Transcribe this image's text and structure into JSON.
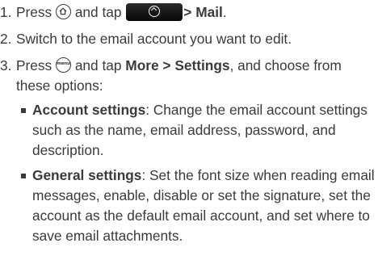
{
  "steps": [
    {
      "number": "1.",
      "press": "Press",
      "and_tap": "and tap",
      "arrow": ">",
      "target": "Mail",
      "end": "."
    },
    {
      "number": "2.",
      "text": "Switch to the email account you want to edit."
    },
    {
      "number": "3.",
      "press": "Press",
      "and_tap": "and tap",
      "more": "More",
      "arrow": ">",
      "settings": "Settings",
      "rest": ", and choose from these options:"
    }
  ],
  "options": [
    {
      "title": "Account settings",
      "description": ": Change the email account settings such as the name, email address, password, and description."
    },
    {
      "title": "General settings",
      "description": ": Set the font size when reading email messages, enable, disable or set the signature, set the account as the default email account, and set where to save email attachments."
    }
  ],
  "icons": {
    "home": "home-key-icon",
    "app_button": "all-apps-button-icon",
    "menu_label": "menu"
  },
  "colors": {
    "text": "#3a3a3a",
    "button": "#070707"
  }
}
